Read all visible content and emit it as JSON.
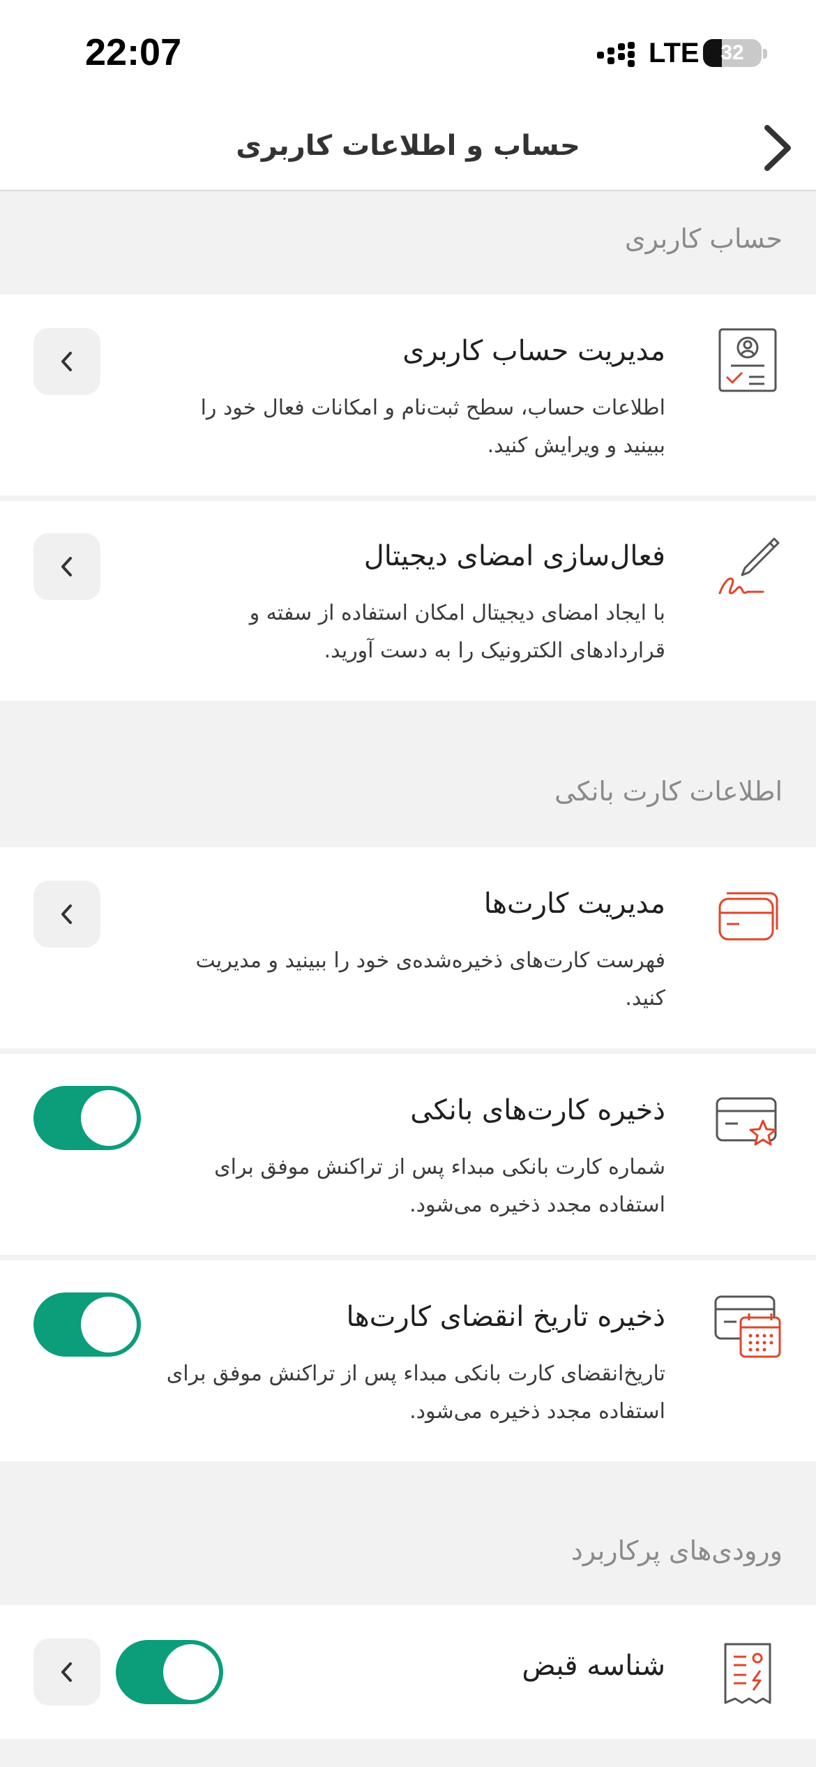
{
  "status_bar": {
    "time": "22:07",
    "network": "LTE",
    "battery_level": "32",
    "battery_fraction": 0.32
  },
  "header": {
    "title": "حساب و اطلاعات کاربری",
    "back_icon": "chevron-right-icon"
  },
  "sections": [
    {
      "title": "حساب کاربری",
      "items": [
        {
          "icon": "user-profile-icon",
          "title": "مدیریت حساب کاربری",
          "description": "اطلاعات حساب، سطح ثبت‌نام و امکانات فعال خود را ببینید و ویرایش کنید.",
          "control": "chevron"
        },
        {
          "icon": "digital-signature-icon",
          "title": "فعال‌سازی امضای دیجیتال",
          "description": "با ایجاد امضای دیجیتال امکان استفاده از سفته و قراردادهای الکترونیک را به دست آورید.",
          "control": "chevron"
        }
      ]
    },
    {
      "title": "اطلاعات کارت بانکی",
      "items": [
        {
          "icon": "cards-icon",
          "title": "مدیریت کارت‌ها",
          "description": "فهرست کارت‌های ذخیره‌شده‌ی خود را ببینید و مدیریت کنید.",
          "control": "chevron"
        },
        {
          "icon": "card-star-icon",
          "title": "ذخیره کارت‌های بانکی",
          "description": "شماره کارت بانکی مبداء پس از تراکنش موفق برای استفاده مجدد ذخیره می‌شود.",
          "control": "toggle",
          "enabled": true
        },
        {
          "icon": "card-calendar-icon",
          "title": "ذخیره تاریخ انقضای کارت‌ها",
          "description": "تاریخ‌انقضای کارت بانکی مبداء پس از تراکنش موفق برای استفاده مجدد ذخیره می‌شود.",
          "control": "toggle",
          "enabled": true
        }
      ]
    },
    {
      "title": "ورودی‌های پرکاربرد",
      "items": [
        {
          "icon": "bill-receipt-icon",
          "title": "شناسه قبض",
          "control": "toggle-and-chevron",
          "enabled": true
        }
      ]
    }
  ],
  "colors": {
    "accent_green": "#0c9d7a",
    "icon_red": "#e0452a",
    "icon_gray": "#555555",
    "background": "#f2f2f2"
  }
}
